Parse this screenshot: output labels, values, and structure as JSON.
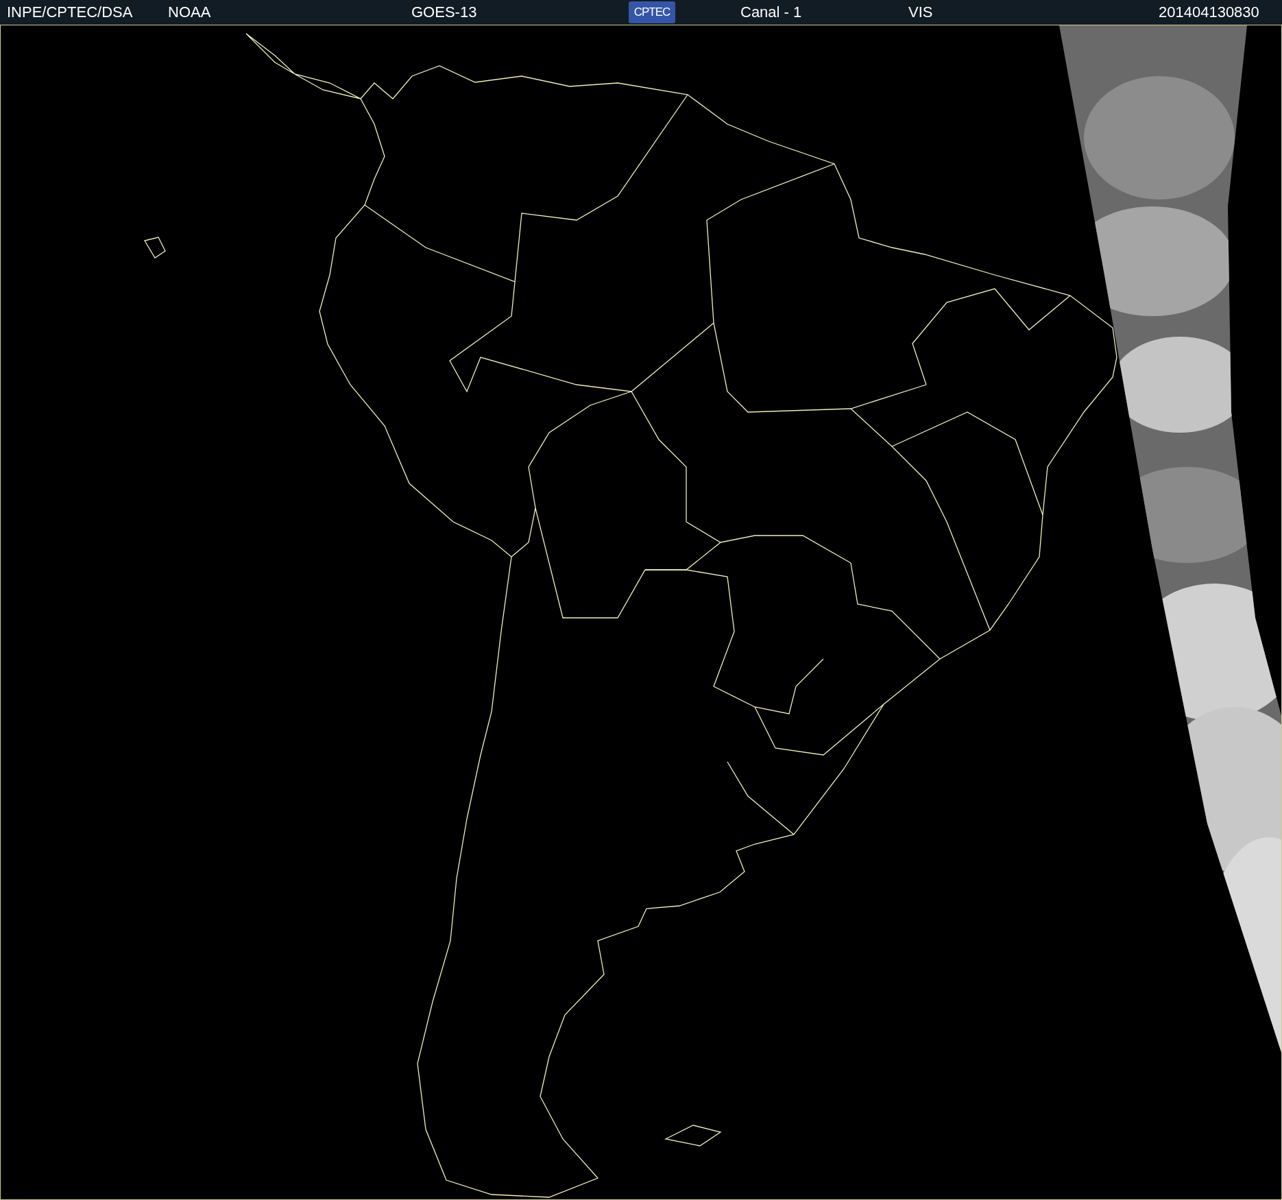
{
  "header": {
    "source": "INPE/CPTEC/DSA",
    "agency": "NOAA",
    "satellite": "GOES-13",
    "logo": "CPTEC",
    "channel": "Canal - 1",
    "band": "VIS",
    "timestamp": "201404130830"
  }
}
